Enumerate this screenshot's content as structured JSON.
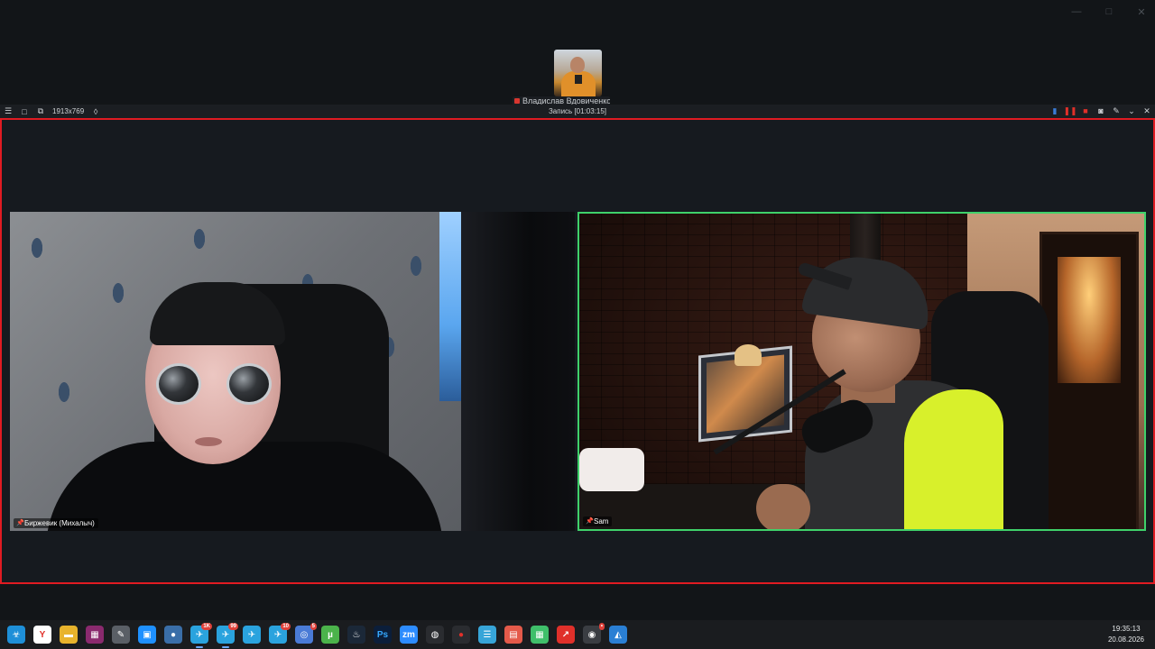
{
  "window_controls": {
    "minimize": "—",
    "maximize": "□",
    "close": "✕"
  },
  "top_participant": {
    "label": "Владислав Вдовиченко"
  },
  "recorder": {
    "resolution": "1913x769",
    "title": "Запись [01:03:15]"
  },
  "participants": [
    {
      "name": "Биржевик (Михалыч)"
    },
    {
      "name": "Sam"
    }
  ],
  "colors": {
    "recording_border": "#e01b22",
    "active_speaker_border": "#3fd16a"
  },
  "taskbar": {
    "icons": [
      {
        "name": "biohazard-icon",
        "glyph": "☣",
        "color": "#1e8fd8"
      },
      {
        "name": "yandex-browser-icon",
        "glyph": "Y",
        "color": "#ffffff",
        "fg": "#e0302a"
      },
      {
        "name": "file-explorer-icon",
        "glyph": "▬",
        "color": "#e8b32c"
      },
      {
        "name": "winrar-icon",
        "glyph": "▦",
        "color": "#8a2a6e"
      },
      {
        "name": "tool-icon",
        "glyph": "✎",
        "color": "#5a5f66"
      },
      {
        "name": "store-icon",
        "glyph": "▣",
        "color": "#1e90ff"
      },
      {
        "name": "orb-icon",
        "glyph": "●",
        "color": "#3a6ea8"
      },
      {
        "name": "telegram-icon-1",
        "glyph": "✈",
        "color": "#2aa3de",
        "badge": "1K",
        "active": true
      },
      {
        "name": "telegram-icon-2",
        "glyph": "✈",
        "color": "#2aa3de",
        "badge": "99",
        "active": true
      },
      {
        "name": "telegram-icon-3",
        "glyph": "✈",
        "color": "#2aa3de"
      },
      {
        "name": "telegram-icon-4",
        "glyph": "✈",
        "color": "#2aa3de",
        "badge": "10"
      },
      {
        "name": "browser-icon",
        "glyph": "◎",
        "color": "#4a7bd6",
        "badge": "5"
      },
      {
        "name": "utorrent-icon",
        "glyph": "µ",
        "color": "#4bb34b"
      },
      {
        "name": "steam-icon",
        "glyph": "♨",
        "color": "#1b2838"
      },
      {
        "name": "photoshop-icon",
        "glyph": "Ps",
        "color": "#0b1e3a",
        "fg": "#35a8ff"
      },
      {
        "name": "zoom-icon",
        "glyph": "zm",
        "color": "#2d8cff"
      },
      {
        "name": "obs-icon",
        "glyph": "◍",
        "color": "#2a2c30"
      },
      {
        "name": "record-icon",
        "glyph": "●",
        "color": "#2a2c30",
        "fg": "#e0302a"
      },
      {
        "name": "notes-icon",
        "glyph": "☰",
        "color": "#37a5d8"
      },
      {
        "name": "pdf-icon",
        "glyph": "▤",
        "color": "#e45a4a"
      },
      {
        "name": "spreadsheet-icon",
        "glyph": "▦",
        "color": "#3fbf6a"
      },
      {
        "name": "arrow-app-icon",
        "glyph": "↗",
        "color": "#e0302a"
      },
      {
        "name": "obs-studio-icon",
        "glyph": "◉",
        "color": "#3a3d42",
        "badge": "•"
      },
      {
        "name": "capture-icon",
        "glyph": "◭",
        "color": "#2a7fd4"
      }
    ],
    "time": "19:35:13",
    "date": "20.08.2026"
  }
}
